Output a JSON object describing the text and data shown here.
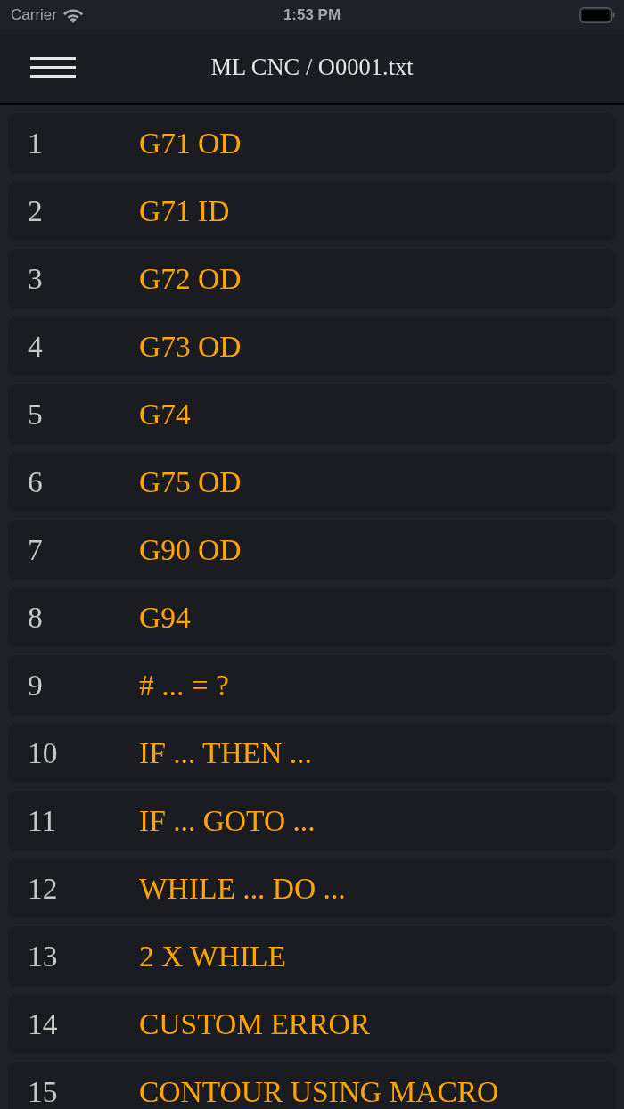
{
  "status_bar": {
    "carrier": "Carrier",
    "time": "1:53 PM"
  },
  "nav_bar": {
    "title": "ML CNC / O0001.txt"
  },
  "rows": [
    {
      "number": "1",
      "name": "G71 OD"
    },
    {
      "number": "2",
      "name": "G71 ID"
    },
    {
      "number": "3",
      "name": "G72 OD"
    },
    {
      "number": "4",
      "name": "G73 OD"
    },
    {
      "number": "5",
      "name": "G74"
    },
    {
      "number": "6",
      "name": "G75 OD"
    },
    {
      "number": "7",
      "name": "G90 OD"
    },
    {
      "number": "8",
      "name": "G94"
    },
    {
      "number": "9",
      "name": "# ... = ?"
    },
    {
      "number": "10",
      "name": "IF ... THEN ..."
    },
    {
      "number": "11",
      "name": "IF ... GOTO ..."
    },
    {
      "number": "12",
      "name": "WHILE ... DO ..."
    },
    {
      "number": "13",
      "name": "2 X WHILE"
    },
    {
      "number": "14",
      "name": "CUSTOM ERROR"
    },
    {
      "number": "15",
      "name": "CONTOUR USING MACRO"
    }
  ]
}
